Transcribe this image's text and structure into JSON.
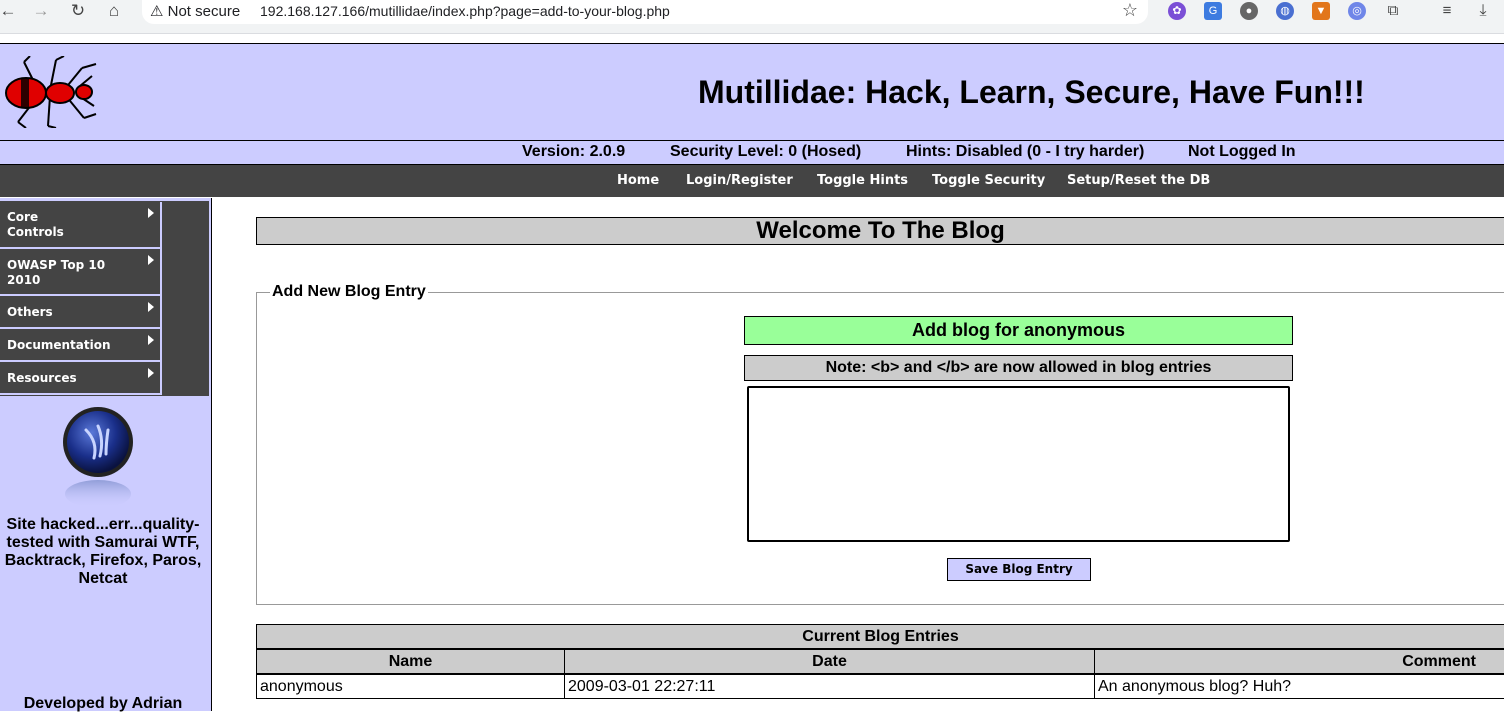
{
  "browser": {
    "security_label": "Not secure",
    "url": "192.168.127.166/mutillidae/index.php?page=add-to-your-blog.php"
  },
  "header": {
    "title": "Mutillidae: Hack, Learn, Secure, Have Fun!!!"
  },
  "status": {
    "version": "Version: 2.0.9",
    "security": "Security Level: 0 (Hosed)",
    "hints": "Hints: Disabled (0 - I try harder)",
    "login": "Not Logged In"
  },
  "menu": {
    "home": "Home",
    "login": "Login/Register",
    "toggle_hints": "Toggle Hints",
    "toggle_security": "Toggle Security",
    "setup": "Setup/Reset the DB"
  },
  "sidebar": {
    "items": [
      {
        "label_line1": "Core",
        "label_line2": "Controls"
      },
      {
        "label_line1": "OWASP Top 10",
        "label_line2": "2010"
      },
      {
        "label_line1": "Others",
        "label_line2": ""
      },
      {
        "label_line1": "Documentation",
        "label_line2": ""
      },
      {
        "label_line1": "Resources",
        "label_line2": ""
      }
    ],
    "hacked_line1": "Site hacked...err...quality-",
    "hacked_line2": "tested with Samurai WTF,",
    "hacked_line3": "Backtrack, Firefox, Paros,",
    "hacked_line4": "Netcat",
    "developed_by": "Developed by Adrian"
  },
  "main": {
    "welcome": "Welcome To The Blog",
    "legend": "Add New Blog Entry",
    "add_for": "Add blog for anonymous",
    "note": "Note: <b> and </b> are now allowed in blog entries",
    "save_button": "Save Blog Entry",
    "table": {
      "title": "Current Blog Entries",
      "headers": {
        "name": "Name",
        "date": "Date",
        "comment": "Comment"
      },
      "rows": [
        {
          "name": "anonymous",
          "date": "2009-03-01 22:27:11",
          "comment": "An anonymous blog? Huh?"
        }
      ]
    }
  },
  "colors": {
    "header_bg": "#ccccff",
    "menu_bg": "#444444",
    "add_label_bg": "#99ff99",
    "gray_bg": "#cccccc"
  }
}
